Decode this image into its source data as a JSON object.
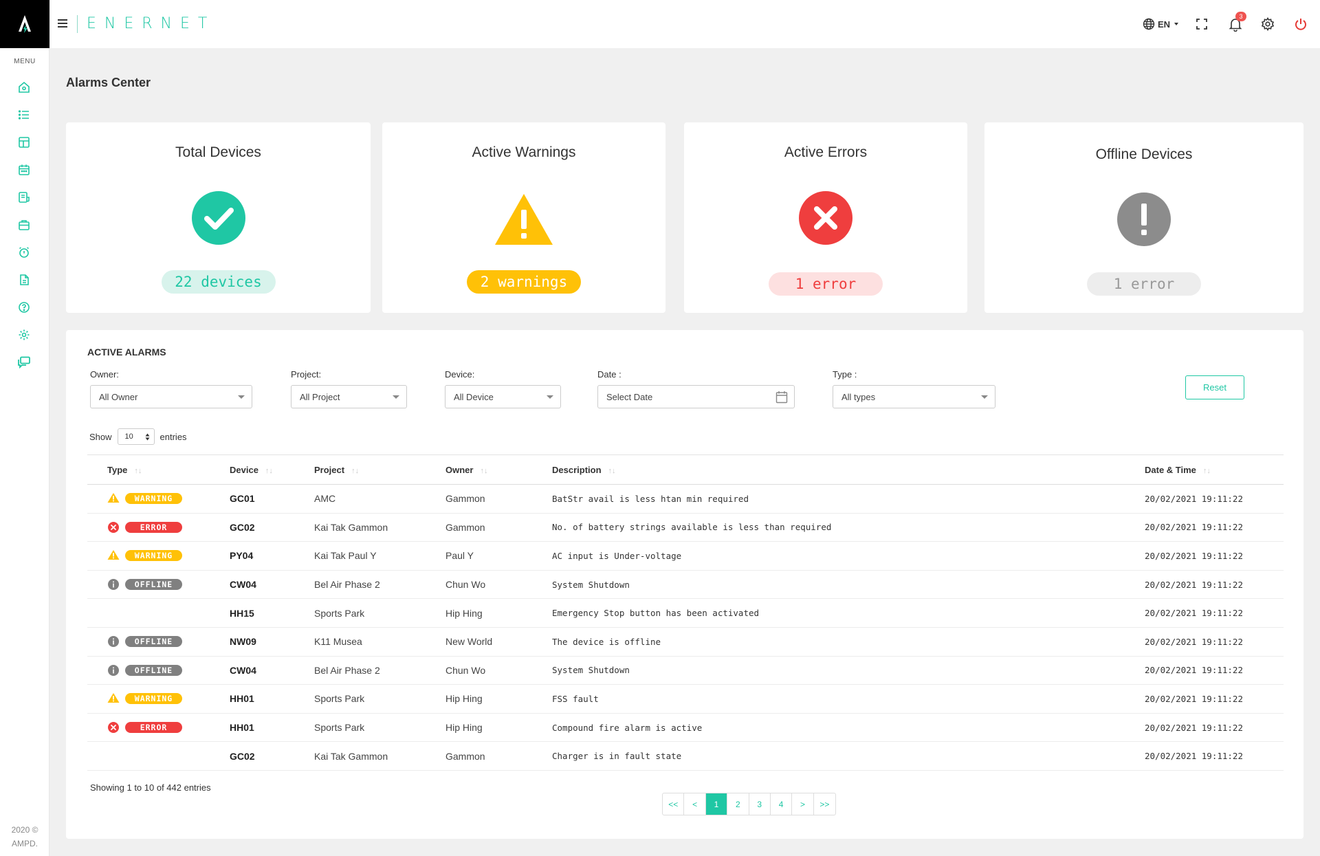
{
  "app": {
    "brand": "ENERNET",
    "footer_line1": "2020 ©",
    "footer_line2": "AMPD."
  },
  "sidebar": {
    "menu_label": "MENU",
    "items": [
      "home-icon",
      "list-icon",
      "layout-icon",
      "calendar-icon",
      "report-icon",
      "briefcase-icon",
      "alarm-clock-icon",
      "document-icon",
      "help-icon",
      "settings-icon",
      "chat-icon"
    ]
  },
  "header": {
    "language": "EN",
    "notification_count": "3"
  },
  "page": {
    "title": "Alarms Center"
  },
  "stats": [
    {
      "title": "Total Devices",
      "value": "22 devices",
      "icon": "check-circle-icon",
      "color": "#1fc7a4"
    },
    {
      "title": "Active Warnings",
      "value": "2 warnings",
      "icon": "warning-triangle-icon",
      "color": "#ffc107"
    },
    {
      "title": "Active Errors",
      "value": "1 error",
      "icon": "error-circle-icon",
      "color": "#ef3e3e"
    },
    {
      "title": "Offline Devices",
      "value": "1 error",
      "icon": "exclamation-circle-icon",
      "color": "#8c8c8c"
    }
  ],
  "alarms": {
    "title": "ACTIVE ALARMS",
    "filters": {
      "owner": {
        "label": "Owner:",
        "value": "All Owner"
      },
      "project": {
        "label": "Project:",
        "value": "All Project"
      },
      "device": {
        "label": "Device:",
        "value": "All Device"
      },
      "date": {
        "label": "Date :",
        "value": "Select Date"
      },
      "type": {
        "label": "Type :",
        "value": "All types"
      }
    },
    "reset_label": "Reset",
    "show_label": "Show",
    "entries_value": "10",
    "entries_label": "entries",
    "columns": [
      "Type",
      "Device",
      "Project",
      "Owner",
      "Description",
      "Date  & Time"
    ],
    "rows": [
      {
        "type": "WARNING",
        "device": "GC01",
        "project": "AMC",
        "owner": "Gammon",
        "description": "BatStr avail is less htan min required",
        "datetime": "20/02/2021 19:11:22"
      },
      {
        "type": "ERROR",
        "device": "GC02",
        "project": "Kai Tak Gammon",
        "owner": "Gammon",
        "description": "No. of battery strings available is less than required",
        "datetime": "20/02/2021 19:11:22"
      },
      {
        "type": "WARNING",
        "device": "PY04",
        "project": "Kai Tak Paul Y",
        "owner": "Paul Y",
        "description": "AC input is Under-voltage",
        "datetime": "20/02/2021 19:11:22"
      },
      {
        "type": "OFFLINE",
        "device": "CW04",
        "project": "Bel Air Phase 2",
        "owner": "Chun Wo",
        "description": "System Shutdown",
        "datetime": "20/02/2021 19:11:22"
      },
      {
        "type": "",
        "device": "HH15",
        "project": "Sports Park",
        "owner": "Hip Hing",
        "description": "Emergency Stop button has been activated",
        "datetime": "20/02/2021 19:11:22"
      },
      {
        "type": "OFFLINE",
        "device": "NW09",
        "project": "K11 Musea",
        "owner": "New World",
        "description": "The device is offline",
        "datetime": "20/02/2021 19:11:22"
      },
      {
        "type": "OFFLINE",
        "device": "CW04",
        "project": "Bel Air Phase 2",
        "owner": "Chun Wo",
        "description": "System Shutdown",
        "datetime": "20/02/2021 19:11:22"
      },
      {
        "type": "WARNING",
        "device": "HH01",
        "project": "Sports Park",
        "owner": "Hip Hing",
        "description": "FSS fault",
        "datetime": "20/02/2021 19:11:22"
      },
      {
        "type": "ERROR",
        "device": "HH01",
        "project": "Sports Park",
        "owner": "Hip Hing",
        "description": "Compound fire alarm is active",
        "datetime": "20/02/2021 19:11:22"
      },
      {
        "type": "",
        "device": "GC02",
        "project": "Kai Tak Gammon",
        "owner": "Gammon",
        "description": "Charger is in fault state",
        "datetime": "20/02/2021 19:11:22"
      }
    ],
    "showing_text": "Showing 1 to 10 of 442 entries",
    "pagination": [
      "<<",
      "<",
      "1",
      "2",
      "3",
      "4",
      ">",
      ">>"
    ],
    "current_page": "1"
  },
  "colors": {
    "accent": "#1fc7a4",
    "warning": "#ffc107",
    "error": "#ef3e3e",
    "offline": "#8c8c8c"
  }
}
